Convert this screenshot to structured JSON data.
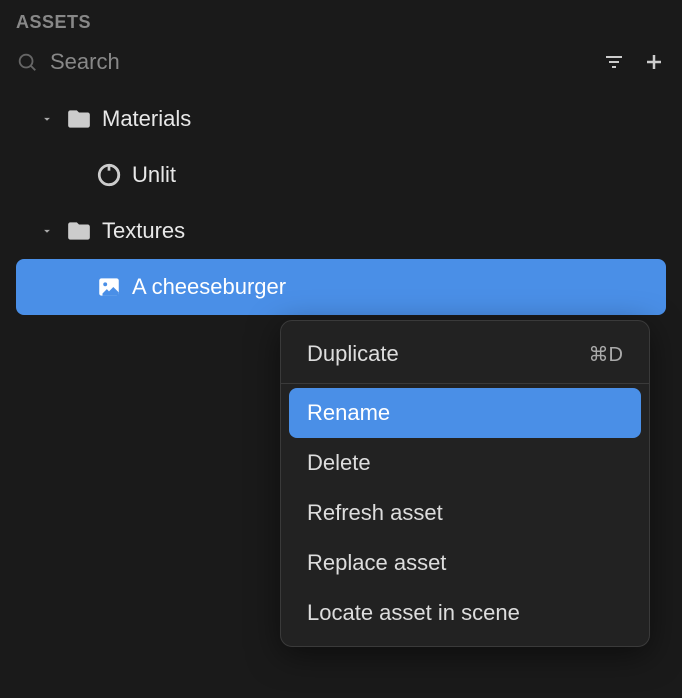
{
  "panel": {
    "title": "ASSETS"
  },
  "search": {
    "placeholder": "Search"
  },
  "tree": {
    "items": [
      {
        "label": "Materials"
      },
      {
        "label": "Unlit"
      },
      {
        "label": "Textures"
      },
      {
        "label": "A cheeseburger"
      }
    ]
  },
  "contextMenu": {
    "items": [
      {
        "label": "Duplicate",
        "shortcut": "⌘D"
      },
      {
        "label": "Rename"
      },
      {
        "label": "Delete"
      },
      {
        "label": "Refresh asset"
      },
      {
        "label": "Replace asset"
      },
      {
        "label": "Locate asset in scene"
      }
    ]
  }
}
